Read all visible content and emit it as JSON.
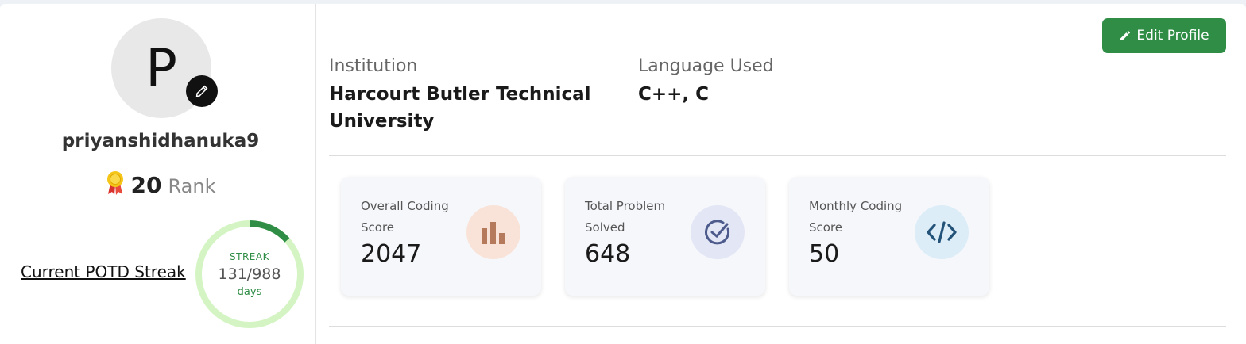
{
  "profile": {
    "avatar_letter": "P",
    "username": "priyanshidhanuka9",
    "rank_value": "20",
    "rank_label": "Rank"
  },
  "streak": {
    "link_label": "Current POTD Streak",
    "title": "STREAK",
    "value": "131/988",
    "unit": "days",
    "current": 131,
    "total": 988,
    "colors": {
      "ring_bg": "#d4f5c3",
      "ring_fg": "#2f8d46"
    }
  },
  "actions": {
    "edit_label": "Edit Profile"
  },
  "info": {
    "institution_label": "Institution",
    "institution_value": "Harcourt Butler Technical University",
    "language_label": "Language Used",
    "language_value": "C++, C"
  },
  "stats": [
    {
      "label": "Overall Coding Score",
      "value": "2047",
      "icon": "bar-chart-icon"
    },
    {
      "label": "Total Problem Solved",
      "value": "648",
      "icon": "check-circle-icon"
    },
    {
      "label": "Monthly Coding Score",
      "value": "50",
      "icon": "code-icon"
    }
  ],
  "colors": {
    "accent": "#2f8d46"
  }
}
